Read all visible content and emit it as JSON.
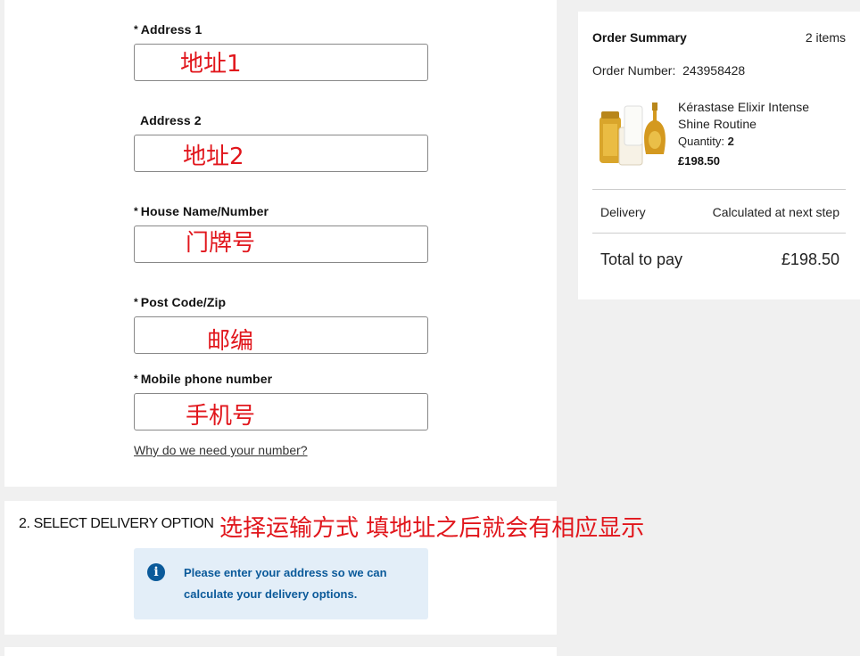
{
  "form": {
    "fields": [
      {
        "label": "Address 1",
        "required": "*",
        "annotation": "地址1"
      },
      {
        "label": "Address 2",
        "required": "",
        "annotation": "地址2"
      },
      {
        "label": "House Name/Number",
        "required": "*",
        "annotation": "门牌号"
      },
      {
        "label": "Post Code/Zip",
        "required": "*",
        "annotation": "邮编"
      },
      {
        "label": "Mobile phone number",
        "required": "*",
        "annotation": "手机号"
      }
    ],
    "help_link": "Why do we need your number?"
  },
  "delivery": {
    "title": "2. Select Delivery Option",
    "info_icon": "i",
    "info_text": "Please enter your address so we can calculate your delivery options.",
    "annotation": "选择运输方式 填地址之后就会有相应显示"
  },
  "summary": {
    "title": "Order Summary",
    "count": "2 items",
    "order_number_label": "Order Number:",
    "order_number": "243958428",
    "product": {
      "name": "Kérastase Elixir Intense Shine Routine",
      "quantity_label": "Quantity:",
      "quantity": "2",
      "price": "£198.50"
    },
    "delivery_label": "Delivery",
    "delivery_value": "Calculated at next step",
    "total_label": "Total to pay",
    "total_value": "£198.50"
  },
  "colors": {
    "annotation": "#e1161c",
    "info_bg": "#e3eef8",
    "info_text": "#0b5a9a",
    "page_bg": "#f0f0f0"
  }
}
